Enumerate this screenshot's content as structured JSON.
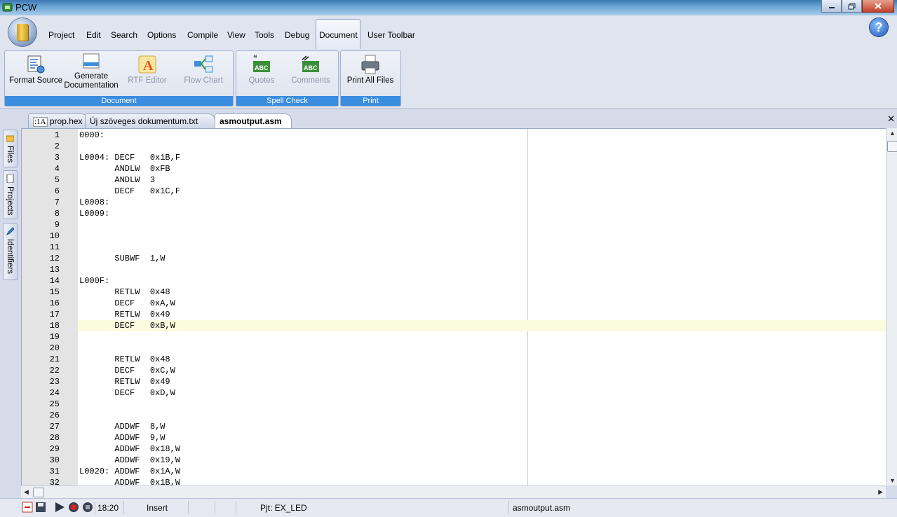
{
  "window": {
    "title": "PCW"
  },
  "menu": {
    "items": [
      "Project",
      "Edit",
      "Search",
      "Options",
      "Compile",
      "View",
      "Tools",
      "Debug",
      "Document",
      "User Toolbar"
    ],
    "active": "Document"
  },
  "ribbon": {
    "groups": [
      {
        "label": "Document"
      },
      {
        "label": "Spell Check"
      },
      {
        "label": "Print"
      }
    ],
    "buttons": {
      "format_source": "Format Source",
      "generate_doc_1": "Generate",
      "generate_doc_2": "Documentation",
      "rtf_editor": "RTF Editor",
      "flow_chart": "Flow Chart",
      "quotes": "Quotes",
      "comments": "Comments",
      "print_all": "Print All Files"
    },
    "icon_text": {
      "abc": "ABC",
      "rtf": "A"
    }
  },
  "tabs": [
    {
      "label": "prop.hex",
      "icon": "hex-file-icon",
      "icon_text": ":1A"
    },
    {
      "label": "Új szöveges dokumentum.txt"
    },
    {
      "label": "asmoutput.asm",
      "active": true
    }
  ],
  "side_tabs": [
    "Files",
    "Projects",
    "Identifiers"
  ],
  "editor": {
    "highlighted_line": 18,
    "lines": [
      {
        "n": "1",
        "code": "0000:"
      },
      {
        "n": "2",
        "code": ""
      },
      {
        "n": "3",
        "code": "L0004: DECF   0x1B,F"
      },
      {
        "n": "4",
        "code": "       ANDLW  0xFB"
      },
      {
        "n": "5",
        "code": "       ANDLW  3"
      },
      {
        "n": "6",
        "code": "       DECF   0x1C,F"
      },
      {
        "n": "7",
        "code": "L0008:"
      },
      {
        "n": "8",
        "code": "L0009:"
      },
      {
        "n": "9",
        "code": ""
      },
      {
        "n": "10",
        "code": ""
      },
      {
        "n": "11",
        "code": ""
      },
      {
        "n": "12",
        "code": "       SUBWF  1,W"
      },
      {
        "n": "13",
        "code": ""
      },
      {
        "n": "14",
        "code": "L000F:"
      },
      {
        "n": "15",
        "code": "       RETLW  0x48"
      },
      {
        "n": "16",
        "code": "       DECF   0xA,W"
      },
      {
        "n": "17",
        "code": "       RETLW  0x49"
      },
      {
        "n": "18",
        "code": "       DECF   0xB,W"
      },
      {
        "n": "19",
        "code": ""
      },
      {
        "n": "20",
        "code": ""
      },
      {
        "n": "21",
        "code": "       RETLW  0x48"
      },
      {
        "n": "22",
        "code": "       DECF   0xC,W"
      },
      {
        "n": "23",
        "code": "       RETLW  0x49"
      },
      {
        "n": "24",
        "code": "       DECF   0xD,W"
      },
      {
        "n": "25",
        "code": ""
      },
      {
        "n": "26",
        "code": ""
      },
      {
        "n": "27",
        "code": "       ADDWF  8,W"
      },
      {
        "n": "28",
        "code": "       ADDWF  9,W"
      },
      {
        "n": "29",
        "code": "       ADDWF  0x18,W"
      },
      {
        "n": "30",
        "code": "       ADDWF  0x19,W"
      },
      {
        "n": "31",
        "code": "L0020: ADDWF  0x1A,W"
      },
      {
        "n": "32",
        "code": "       ADDWF  0x1B,W"
      }
    ]
  },
  "status": {
    "time": "18:20",
    "mode": "Insert",
    "project": "Pjt: EX_LED",
    "file": "asmoutput.asm"
  },
  "colors": {
    "ribbon_group_label": "#3b8de0",
    "highlight_line": "#fbfbdf",
    "gutter": "#e4e4e4"
  }
}
